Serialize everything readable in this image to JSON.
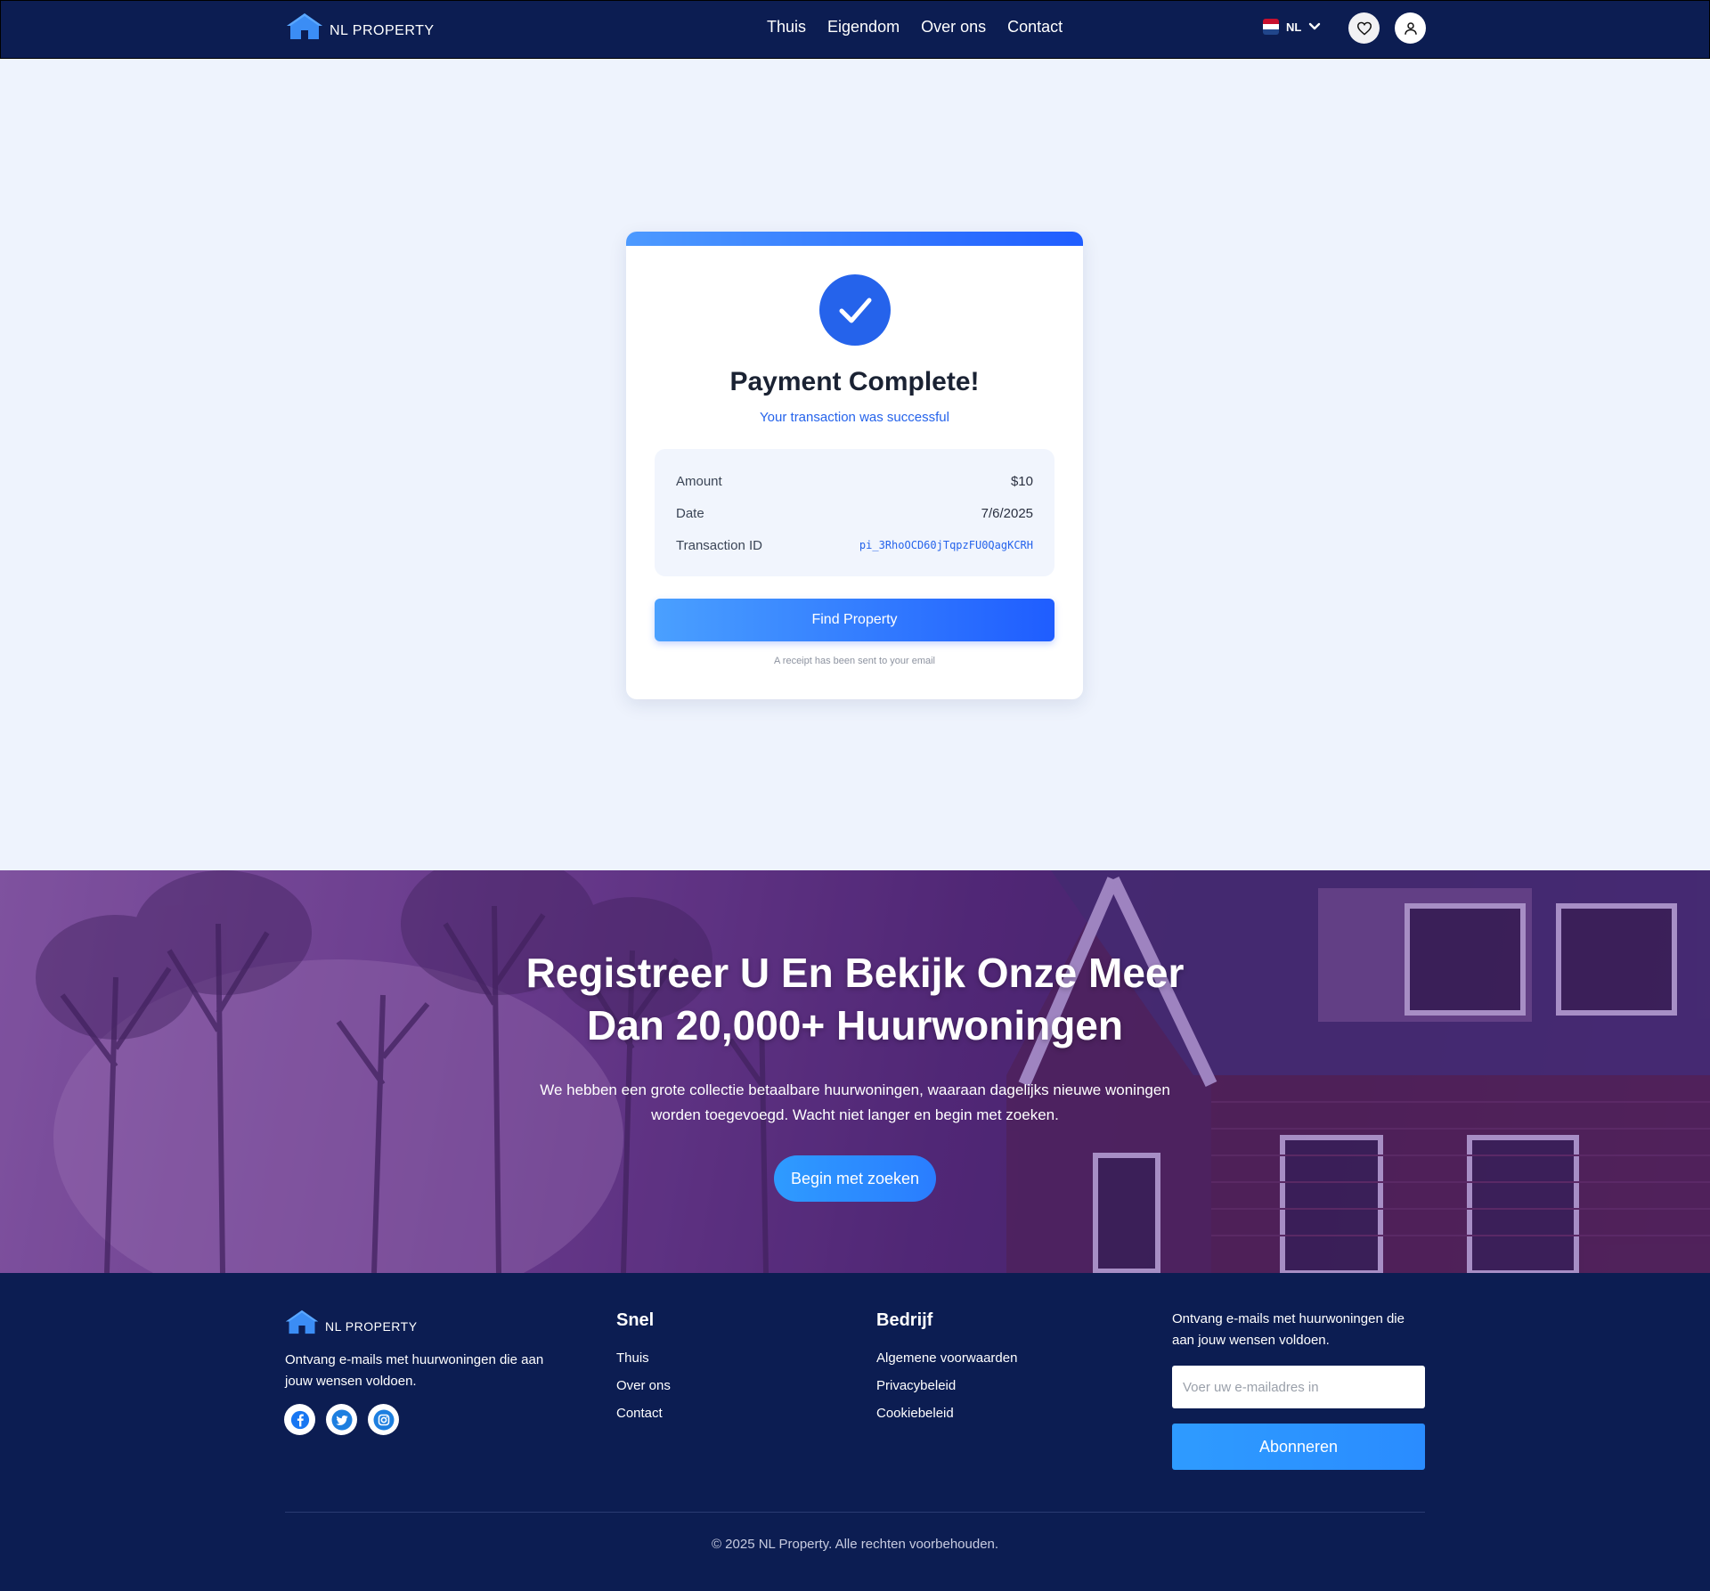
{
  "header": {
    "brand": "NL PROPERTY",
    "nav": [
      "Thuis",
      "Eigendom",
      "Over ons",
      "Contact"
    ],
    "language": "NL",
    "icons": {
      "favorites": "heart-icon",
      "account": "user-icon",
      "language_dropdown": "chevron-down-icon"
    }
  },
  "payment": {
    "title": "Payment Complete!",
    "subtitle": "Your transaction was successful",
    "rows": [
      {
        "label": "Amount",
        "value": "$10"
      },
      {
        "label": "Date",
        "value": "7/6/2025"
      },
      {
        "label": "Transaction ID",
        "value": "pi_3RhoOCD60jTqpzFU0QagKCRH"
      }
    ],
    "button": "Find Property",
    "receipt_note": "A receipt has been sent to your email"
  },
  "banner": {
    "title_line1": "Registreer U En Bekijk Onze Meer",
    "title_line2": "Dan 20,000+ Huurwoningen",
    "text_line1": "We hebben een grote collectie betaalbare huurwoningen, waaraan dagelijks nieuwe woningen",
    "text_line2": "worden toegevoegd. Wacht niet langer en begin met zoeken.",
    "button": "Begin met zoeken"
  },
  "footer": {
    "brand": "NL PROPERTY",
    "description": "Ontvang e-mails met huurwoningen die aan jouw wensen voldoen.",
    "socials": [
      "facebook-icon",
      "twitter-icon",
      "instagram-icon"
    ],
    "snel": {
      "heading": "Snel",
      "links": [
        "Thuis",
        "Over ons",
        "Contact"
      ]
    },
    "bedrijf": {
      "heading": "Bedrijf",
      "links": [
        "Algemene voorwaarden",
        "Privacybeleid",
        "Cookiebeleid"
      ]
    },
    "newsletter": {
      "text": "Ontvang e-mails met huurwoningen die aan jouw wensen voldoen.",
      "placeholder": "Voer uw e-mailadres in",
      "button": "Abonneren"
    },
    "copyright": "© 2025 NL Property. Alle rechten voorbehouden."
  },
  "colors": {
    "navy": "#0c1d52",
    "accent_blue": "#2563eb",
    "button_blue": "#2e9bff",
    "page_bg": "#eef3fd"
  }
}
